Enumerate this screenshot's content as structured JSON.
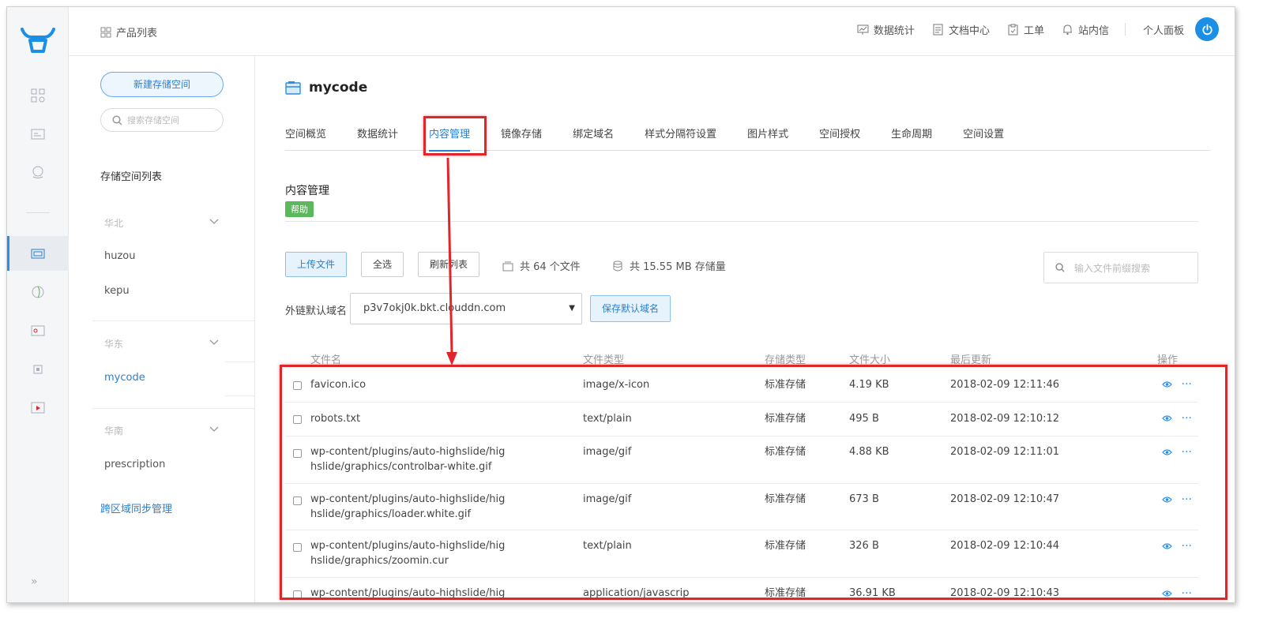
{
  "topbar": {
    "product_list": "产品列表",
    "links": [
      "数据统计",
      "文档中心",
      "工单",
      "站内信"
    ],
    "personal_panel": "个人面板"
  },
  "sidebar": {
    "new_bucket": "新建存储空间",
    "search_placeholder": "搜索存储空间",
    "list_title": "存储空间列表",
    "regions": [
      {
        "name": "华北",
        "buckets": [
          "huzou",
          "kepu"
        ]
      },
      {
        "name": "华东",
        "buckets": [
          "mycode"
        ]
      },
      {
        "name": "华南",
        "buckets": [
          "prescription"
        ]
      }
    ],
    "active_bucket": "mycode",
    "cross_region_sync": "跨区域同步管理"
  },
  "main": {
    "bucket_name": "mycode",
    "tabs": [
      "空间概览",
      "数据统计",
      "内容管理",
      "镜像存储",
      "绑定域名",
      "样式分隔符设置",
      "图片样式",
      "空间授权",
      "生命周期",
      "空间设置"
    ],
    "active_tab": "内容管理",
    "section_title": "内容管理",
    "help": "帮助",
    "buttons": {
      "upload": "上传文件",
      "select_all": "全选",
      "refresh": "刷新列表"
    },
    "file_count": "共 64 个文件",
    "storage_used": "共 15.55 MB 存储量",
    "file_search_placeholder": "输入文件前缀搜索",
    "domain_label": "外链默认域名",
    "domain_value": "p3v7okj0k.bkt.clouddn.com",
    "save_domain": "保存默认域名",
    "table": {
      "headers": [
        "文件名",
        "文件类型",
        "存储类型",
        "文件大小",
        "最后更新",
        "操作"
      ],
      "rows": [
        {
          "name1": "favicon.ico",
          "name2": "",
          "type": "image/x-icon",
          "storage": "标准存储",
          "size": "4.19 KB",
          "updated": "2018-02-09 12:11:46"
        },
        {
          "name1": "robots.txt",
          "name2": "",
          "type": "text/plain",
          "storage": "标准存储",
          "size": "495 B",
          "updated": "2018-02-09 12:10:12"
        },
        {
          "name1": "wp-content/plugins/auto-highslide/hig",
          "name2": "hslide/graphics/controlbar-white.gif",
          "type": "image/gif",
          "storage": "标准存储",
          "size": "4.88 KB",
          "updated": "2018-02-09 12:11:01"
        },
        {
          "name1": "wp-content/plugins/auto-highslide/hig",
          "name2": "hslide/graphics/loader.white.gif",
          "type": "image/gif",
          "storage": "标准存储",
          "size": "673 B",
          "updated": "2018-02-09 12:10:47"
        },
        {
          "name1": "wp-content/plugins/auto-highslide/hig",
          "name2": "hslide/graphics/zoomin.cur",
          "type": "text/plain",
          "storage": "标准存储",
          "size": "326 B",
          "updated": "2018-02-09 12:10:44"
        },
        {
          "name1": "wp-content/plugins/auto-highslide/hig",
          "name2": "",
          "type": "application/javascrip",
          "storage": "标准存储",
          "size": "36.91 KB",
          "updated": "2018-02-09 12:10:43"
        }
      ]
    }
  },
  "colors": {
    "accent": "#2b7fd0",
    "highlight": "#e0262b",
    "help_badge": "#5cb85c"
  }
}
